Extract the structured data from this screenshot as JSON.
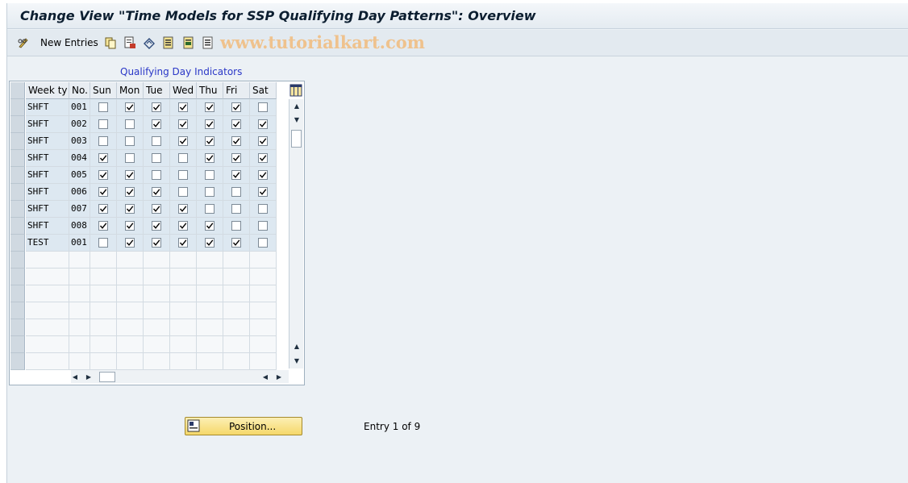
{
  "window": {
    "title": "Change View \"Time Models for SSP Qualifying Day Patterns\": Overview"
  },
  "toolbar": {
    "new_entries_label": "New Entries",
    "watermark": "www.tutorialkart.com",
    "icons": [
      "pen-glasses-icon",
      "copy-icon",
      "delete-icon",
      "undo-icon",
      "select-all-icon",
      "select-block-icon",
      "deselect-icon"
    ]
  },
  "table": {
    "section_title": "Qualifying Day Indicators",
    "columns": [
      "Week ty",
      "No.",
      "Sun",
      "Mon",
      "Tue",
      "Wed",
      "Thu",
      "Fri",
      "Sat"
    ],
    "rows": [
      {
        "week": "SHFT",
        "no": "001",
        "days": [
          false,
          true,
          true,
          true,
          true,
          true,
          false
        ]
      },
      {
        "week": "SHFT",
        "no": "002",
        "days": [
          false,
          false,
          true,
          true,
          true,
          true,
          true
        ]
      },
      {
        "week": "SHFT",
        "no": "003",
        "days": [
          false,
          false,
          false,
          true,
          true,
          true,
          true
        ]
      },
      {
        "week": "SHFT",
        "no": "004",
        "days": [
          true,
          false,
          false,
          false,
          true,
          true,
          true
        ]
      },
      {
        "week": "SHFT",
        "no": "005",
        "days": [
          true,
          true,
          false,
          false,
          false,
          true,
          true
        ]
      },
      {
        "week": "SHFT",
        "no": "006",
        "days": [
          true,
          true,
          true,
          false,
          false,
          false,
          true
        ]
      },
      {
        "week": "SHFT",
        "no": "007",
        "days": [
          true,
          true,
          true,
          true,
          false,
          false,
          false
        ]
      },
      {
        "week": "SHFT",
        "no": "008",
        "days": [
          true,
          true,
          true,
          true,
          true,
          false,
          false
        ]
      },
      {
        "week": "TEST",
        "no": "001",
        "days": [
          false,
          true,
          true,
          true,
          true,
          true,
          false
        ]
      }
    ],
    "empty_rows": 7
  },
  "footer": {
    "position_label": "Position...",
    "entry_text": "Entry 1 of 9"
  },
  "colors": {
    "frame_bg": "#ecf1f5",
    "row_bg": "#dde8f1",
    "header_bg": "#e8edf2",
    "section_title": "#2a37c7",
    "button_bg": "#f5d86a"
  }
}
